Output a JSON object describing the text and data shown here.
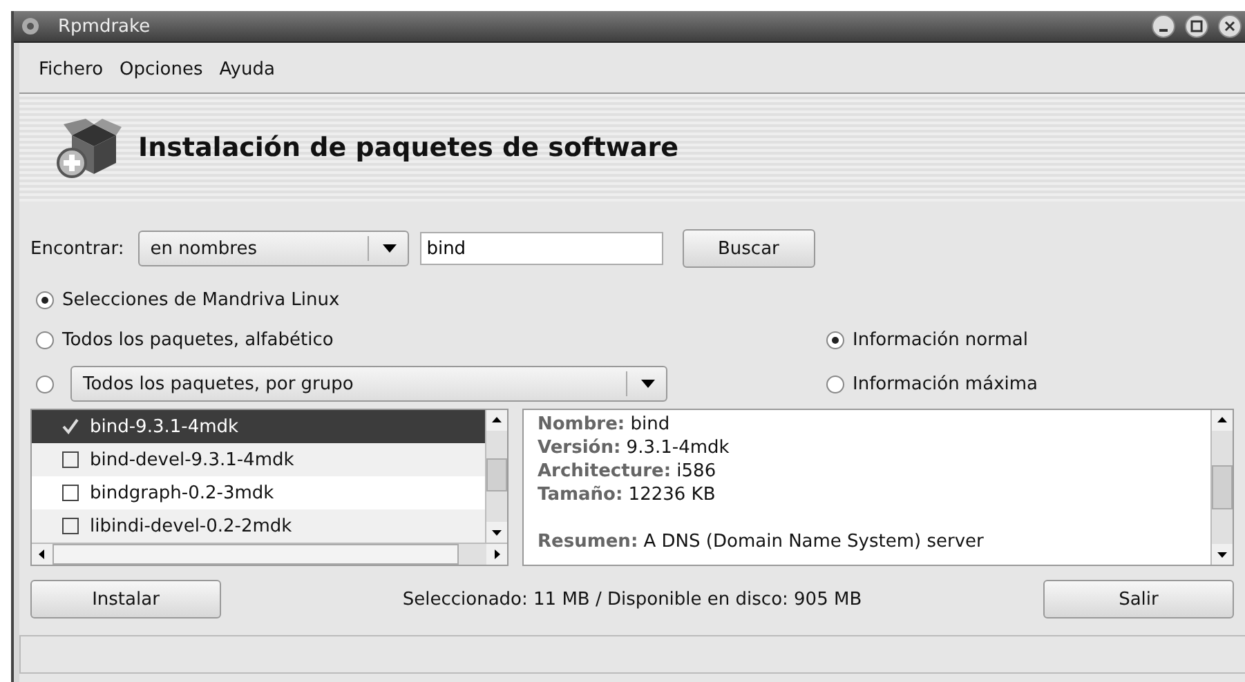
{
  "window": {
    "title": "Rpmdrake"
  },
  "menu": [
    {
      "label": "Fichero"
    },
    {
      "label": "Opciones"
    },
    {
      "label": "Ayuda"
    }
  ],
  "header": {
    "title": "Instalación de paquetes de software"
  },
  "search": {
    "label": "Encontrar:",
    "mode": "en nombres",
    "value": "bind",
    "button": "Buscar"
  },
  "views": [
    {
      "label": "Selecciones de Mandriva Linux",
      "selected": true,
      "kind": "radio"
    },
    {
      "label": "Todos los paquetes, alfabético",
      "selected": false,
      "kind": "radio"
    },
    {
      "label": "Todos los paquetes, por grupo",
      "selected": false,
      "kind": "combo"
    }
  ],
  "info_modes": [
    {
      "label": "Información normal",
      "selected": true
    },
    {
      "label": "Información máxima",
      "selected": false
    }
  ],
  "packages": [
    {
      "name": "bind-9.3.1-4mdk",
      "checked": true,
      "selected": true
    },
    {
      "name": "bind-devel-9.3.1-4mdk",
      "checked": false,
      "selected": false
    },
    {
      "name": "bindgraph-0.2-3mdk",
      "checked": false,
      "selected": false
    },
    {
      "name": "libindi-devel-0.2-2mdk",
      "checked": false,
      "selected": false
    }
  ],
  "details": [
    {
      "label": "Nombre:",
      "value": "bind",
      "spaced": false
    },
    {
      "label": "Versión:",
      "value": "9.3.1-4mdk",
      "spaced": false
    },
    {
      "label": "Architecture:",
      "value": "i586",
      "spaced": false
    },
    {
      "label": "Tamaño:",
      "value": "12236 KB",
      "spaced": false
    },
    {
      "label": "Resumen:",
      "value": "A DNS (Domain Name System) server",
      "spaced": true
    }
  ],
  "footer": {
    "install": "Instalar",
    "status": "Seleccionado: 11 MB / Disponible en disco: 905 MB",
    "quit": "Salir"
  }
}
